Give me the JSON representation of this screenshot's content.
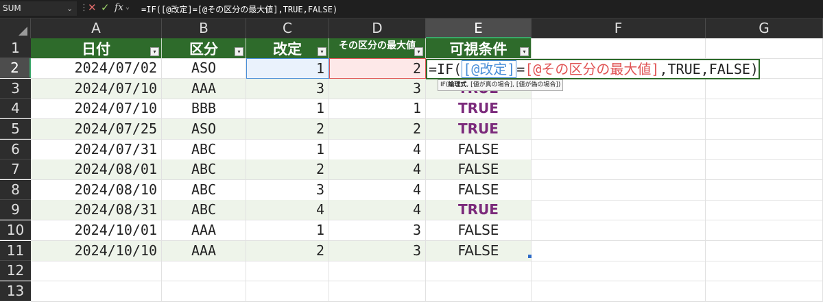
{
  "formula_bar": {
    "name_box": "SUM",
    "fx": "fx",
    "formula": "=IF([@改定]=[@その区分の最大値],TRUE,FALSE)"
  },
  "columns": [
    "A",
    "B",
    "C",
    "D",
    "E",
    "F",
    "G"
  ],
  "rows": [
    "1",
    "2",
    "3",
    "4",
    "5",
    "6",
    "7",
    "8",
    "9",
    "10",
    "11",
    "12",
    "13"
  ],
  "table": {
    "headers": [
      "日付",
      "区分",
      "改定",
      "その区分の最大値",
      "可視条件"
    ],
    "data": [
      {
        "date": "2024/07/02",
        "kubun": "ASO",
        "kaitei": "1",
        "max": "2",
        "cond": ""
      },
      {
        "date": "2024/07/10",
        "kubun": "AAA",
        "kaitei": "3",
        "max": "3",
        "cond": "TRUE"
      },
      {
        "date": "2024/07/10",
        "kubun": "BBB",
        "kaitei": "1",
        "max": "1",
        "cond": "TRUE"
      },
      {
        "date": "2024/07/25",
        "kubun": "ASO",
        "kaitei": "2",
        "max": "2",
        "cond": "TRUE"
      },
      {
        "date": "2024/07/31",
        "kubun": "ABC",
        "kaitei": "1",
        "max": "4",
        "cond": "FALSE"
      },
      {
        "date": "2024/08/01",
        "kubun": "ABC",
        "kaitei": "2",
        "max": "4",
        "cond": "FALSE"
      },
      {
        "date": "2024/08/10",
        "kubun": "ABC",
        "kaitei": "3",
        "max": "4",
        "cond": "FALSE"
      },
      {
        "date": "2024/08/31",
        "kubun": "ABC",
        "kaitei": "4",
        "max": "4",
        "cond": "TRUE"
      },
      {
        "date": "2024/10/01",
        "kubun": "AAA",
        "kaitei": "1",
        "max": "3",
        "cond": "FALSE"
      },
      {
        "date": "2024/10/10",
        "kubun": "AAA",
        "kaitei": "2",
        "max": "3",
        "cond": "FALSE"
      }
    ]
  },
  "edit": {
    "part1": "=IF(",
    "ref1": "[@改定]",
    "eq": "=",
    "ref2": "[@その区分の最大値]",
    "rest": ",TRUE,FALSE)"
  },
  "tooltip": {
    "fn": "IF(",
    "arg1": "論理式",
    "rest": ", [値が真の場合], [値が偽の場合])"
  },
  "colors": {
    "table_header": "#2e6b2b",
    "band": "#eef4ea",
    "true_text": "#7b2a7b",
    "ref_blue": "#4a8fd8",
    "ref_red": "#e05353"
  }
}
